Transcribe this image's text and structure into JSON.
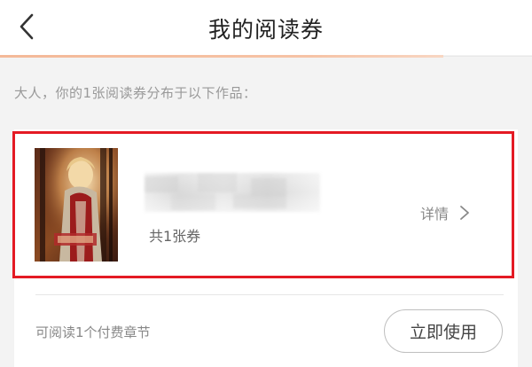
{
  "header": {
    "title": "我的阅读券"
  },
  "intro": {
    "text": "大人，你的1张阅读券分布于以下作品："
  },
  "card": {
    "ticket_count": "共1张券",
    "detail_label": "详情",
    "readable_text": "可阅读1个付费章节",
    "use_button_label": "立即使用"
  },
  "colors": {
    "highlight_border": "#e41a24",
    "header_underline": "#f6c3a6",
    "page_background": "#f3f3f3"
  },
  "icons": {
    "back": "chevron-left-icon",
    "detail": "chevron-right-icon"
  }
}
